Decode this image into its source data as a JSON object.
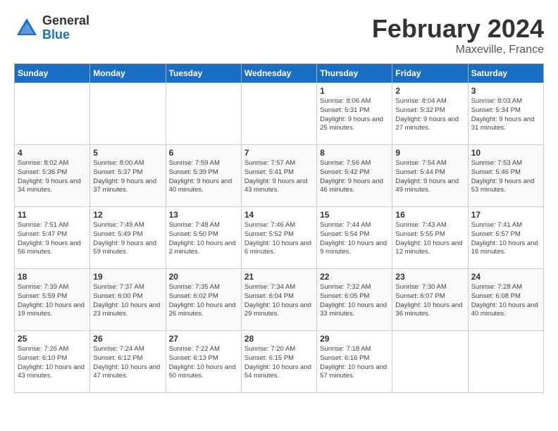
{
  "logo": {
    "general": "General",
    "blue": "Blue"
  },
  "title": "February 2024",
  "subtitle": "Maxeville, France",
  "days_header": [
    "Sunday",
    "Monday",
    "Tuesday",
    "Wednesday",
    "Thursday",
    "Friday",
    "Saturday"
  ],
  "weeks": [
    [
      {
        "day": "",
        "info": ""
      },
      {
        "day": "",
        "info": ""
      },
      {
        "day": "",
        "info": ""
      },
      {
        "day": "",
        "info": ""
      },
      {
        "day": "1",
        "info": "Sunrise: 8:06 AM\nSunset: 5:31 PM\nDaylight: 9 hours\nand 25 minutes."
      },
      {
        "day": "2",
        "info": "Sunrise: 8:04 AM\nSunset: 5:32 PM\nDaylight: 9 hours\nand 27 minutes."
      },
      {
        "day": "3",
        "info": "Sunrise: 8:03 AM\nSunset: 5:34 PM\nDaylight: 9 hours\nand 31 minutes."
      }
    ],
    [
      {
        "day": "4",
        "info": "Sunrise: 8:02 AM\nSunset: 5:36 PM\nDaylight: 9 hours\nand 34 minutes."
      },
      {
        "day": "5",
        "info": "Sunrise: 8:00 AM\nSunset: 5:37 PM\nDaylight: 9 hours\nand 37 minutes."
      },
      {
        "day": "6",
        "info": "Sunrise: 7:59 AM\nSunset: 5:39 PM\nDaylight: 9 hours\nand 40 minutes."
      },
      {
        "day": "7",
        "info": "Sunrise: 7:57 AM\nSunset: 5:41 PM\nDaylight: 9 hours\nand 43 minutes."
      },
      {
        "day": "8",
        "info": "Sunrise: 7:56 AM\nSunset: 5:42 PM\nDaylight: 9 hours\nand 46 minutes."
      },
      {
        "day": "9",
        "info": "Sunrise: 7:54 AM\nSunset: 5:44 PM\nDaylight: 9 hours\nand 49 minutes."
      },
      {
        "day": "10",
        "info": "Sunrise: 7:53 AM\nSunset: 5:46 PM\nDaylight: 9 hours\nand 53 minutes."
      }
    ],
    [
      {
        "day": "11",
        "info": "Sunrise: 7:51 AM\nSunset: 5:47 PM\nDaylight: 9 hours\nand 56 minutes."
      },
      {
        "day": "12",
        "info": "Sunrise: 7:49 AM\nSunset: 5:49 PM\nDaylight: 9 hours\nand 59 minutes."
      },
      {
        "day": "13",
        "info": "Sunrise: 7:48 AM\nSunset: 5:50 PM\nDaylight: 10 hours\nand 2 minutes."
      },
      {
        "day": "14",
        "info": "Sunrise: 7:46 AM\nSunset: 5:52 PM\nDaylight: 10 hours\nand 6 minutes."
      },
      {
        "day": "15",
        "info": "Sunrise: 7:44 AM\nSunset: 5:54 PM\nDaylight: 10 hours\nand 9 minutes."
      },
      {
        "day": "16",
        "info": "Sunrise: 7:43 AM\nSunset: 5:55 PM\nDaylight: 10 hours\nand 12 minutes."
      },
      {
        "day": "17",
        "info": "Sunrise: 7:41 AM\nSunset: 5:57 PM\nDaylight: 10 hours\nand 16 minutes."
      }
    ],
    [
      {
        "day": "18",
        "info": "Sunrise: 7:39 AM\nSunset: 5:59 PM\nDaylight: 10 hours\nand 19 minutes."
      },
      {
        "day": "19",
        "info": "Sunrise: 7:37 AM\nSunset: 6:00 PM\nDaylight: 10 hours\nand 23 minutes."
      },
      {
        "day": "20",
        "info": "Sunrise: 7:35 AM\nSunset: 6:02 PM\nDaylight: 10 hours\nand 26 minutes."
      },
      {
        "day": "21",
        "info": "Sunrise: 7:34 AM\nSunset: 6:04 PM\nDaylight: 10 hours\nand 29 minutes."
      },
      {
        "day": "22",
        "info": "Sunrise: 7:32 AM\nSunset: 6:05 PM\nDaylight: 10 hours\nand 33 minutes."
      },
      {
        "day": "23",
        "info": "Sunrise: 7:30 AM\nSunset: 6:07 PM\nDaylight: 10 hours\nand 36 minutes."
      },
      {
        "day": "24",
        "info": "Sunrise: 7:28 AM\nSunset: 6:08 PM\nDaylight: 10 hours\nand 40 minutes."
      }
    ],
    [
      {
        "day": "25",
        "info": "Sunrise: 7:26 AM\nSunset: 6:10 PM\nDaylight: 10 hours\nand 43 minutes."
      },
      {
        "day": "26",
        "info": "Sunrise: 7:24 AM\nSunset: 6:12 PM\nDaylight: 10 hours\nand 47 minutes."
      },
      {
        "day": "27",
        "info": "Sunrise: 7:22 AM\nSunset: 6:13 PM\nDaylight: 10 hours\nand 50 minutes."
      },
      {
        "day": "28",
        "info": "Sunrise: 7:20 AM\nSunset: 6:15 PM\nDaylight: 10 hours\nand 54 minutes."
      },
      {
        "day": "29",
        "info": "Sunrise: 7:18 AM\nSunset: 6:16 PM\nDaylight: 10 hours\nand 57 minutes."
      },
      {
        "day": "",
        "info": ""
      },
      {
        "day": "",
        "info": ""
      }
    ]
  ]
}
